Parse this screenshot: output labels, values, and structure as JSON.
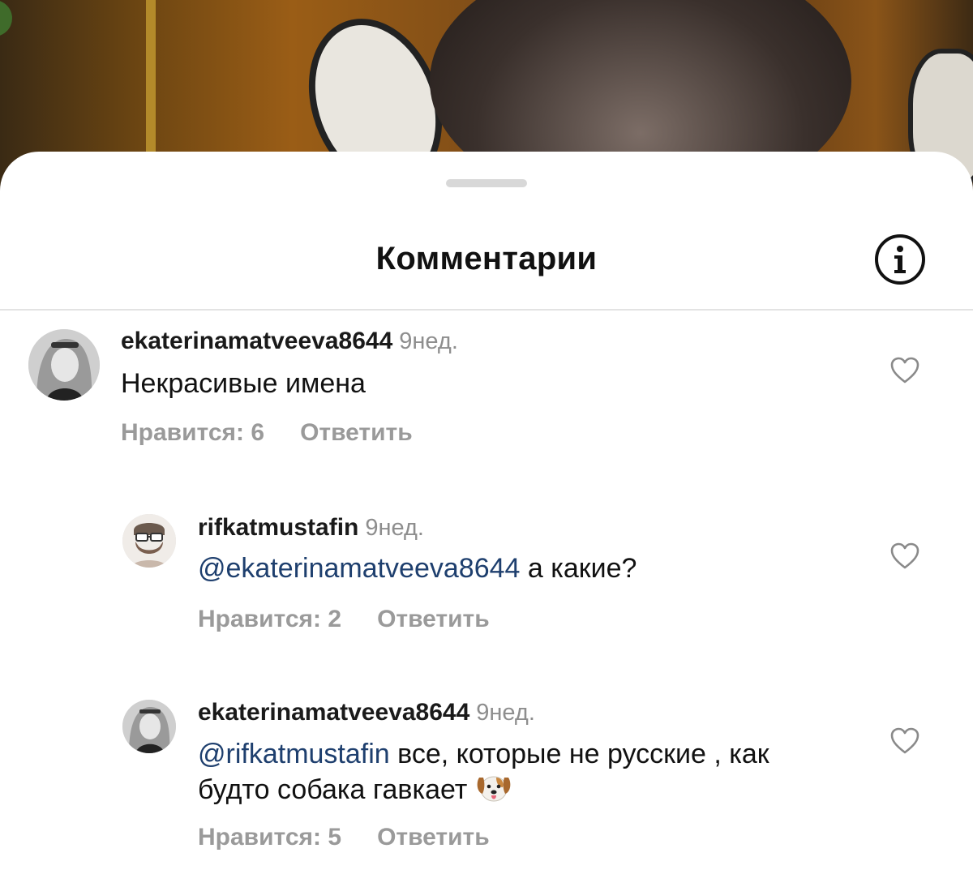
{
  "header": {
    "title": "Комментарии"
  },
  "comments": [
    {
      "username": "ekaterinamatveeva8644",
      "time": "9нед.",
      "text": "Некрасивые имена",
      "likes": "Нравится: 6",
      "reply": "Ответить"
    },
    {
      "username": "rifkatmustafin",
      "time": "9нед.",
      "mention": "@ekaterinamatveeva8644",
      "text": " а какие?",
      "likes": "Нравится: 2",
      "reply": "Ответить"
    },
    {
      "username": "ekaterinamatveeva8644",
      "time": "9нед.",
      "mention": "@rifkatmustafin",
      "text_line1": " все, которые не русские , как",
      "text_line2": "будто собака гавкает ",
      "likes": "Нравится: 5",
      "reply": "Ответить"
    }
  ],
  "icons": {
    "info": "info-icon",
    "like": "heart-icon",
    "emoji": "dog-face-emoji"
  }
}
